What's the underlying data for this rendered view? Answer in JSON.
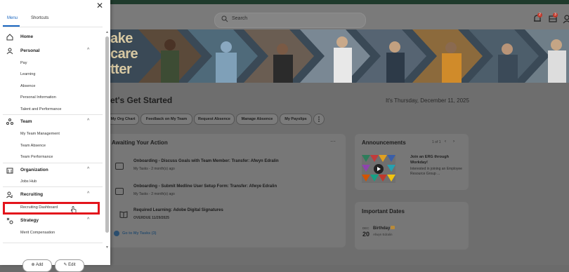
{
  "menu": {
    "tabs": [
      "Menu",
      "Shortcuts"
    ],
    "home": "Home",
    "sections": [
      {
        "label": "Personal",
        "items": [
          "Pay",
          "Learning",
          "Absence",
          "Personal Information",
          "Talent and Performance"
        ]
      },
      {
        "label": "Team",
        "items": [
          "My Team Management",
          "Team Absence",
          "Team Performance"
        ]
      },
      {
        "label": "Organization",
        "items": [
          "Jobs Hub"
        ]
      },
      {
        "label": "Recruiting",
        "items": [
          "Recruiting Dashboard"
        ]
      },
      {
        "label": "Strategy",
        "items": [
          "Merit Compensation"
        ]
      }
    ],
    "bottom_buttons": [
      "Add",
      "Edit"
    ]
  },
  "header": {
    "search_placeholder": "Search",
    "notif_count": "2",
    "inbox_count": "3"
  },
  "banner": {
    "line1": "ake",
    "line2": "care",
    "line3": "tter"
  },
  "main": {
    "title": "et's Get Started",
    "date": "It's Thursday, December 11, 2025",
    "quick_links": [
      "My Org Chart",
      "Feedback on My Team",
      "Request Absence",
      "Manage Absence",
      "My Payslips"
    ],
    "awaiting_title": "Awaiting Your Action",
    "tasks": [
      {
        "title": "Onboarding - Discuss Goals with Team Member: Transfer: Afwyn Edralin",
        "meta": "My Tasks - 2 month(s) ago"
      },
      {
        "title": "Onboarding - Submit Medline User Setup Form: Transfer: Afwye Edralin",
        "meta": "My Tasks - 2 month(s) ago"
      },
      {
        "title": "Required Learning: Adobe Digital Signatures",
        "meta": "OVERDUE 11/29/2025"
      }
    ],
    "go_to_tasks": "Go to My Tasks (3)",
    "announcements_title": "Announcements",
    "announcement_pager": "1 of 1",
    "announcement_head": "Join an ERG through Workday!",
    "announcement_body": "Interested in joining an Employee Resource Group ...",
    "important_dates_title": "Important Dates",
    "date_month": "DEC",
    "date_day": "20",
    "date_event": "Birthday",
    "date_person": "Afwyn Edralin"
  },
  "colors": {
    "accent": "#1a66c0",
    "highlight": "#e3141c"
  }
}
